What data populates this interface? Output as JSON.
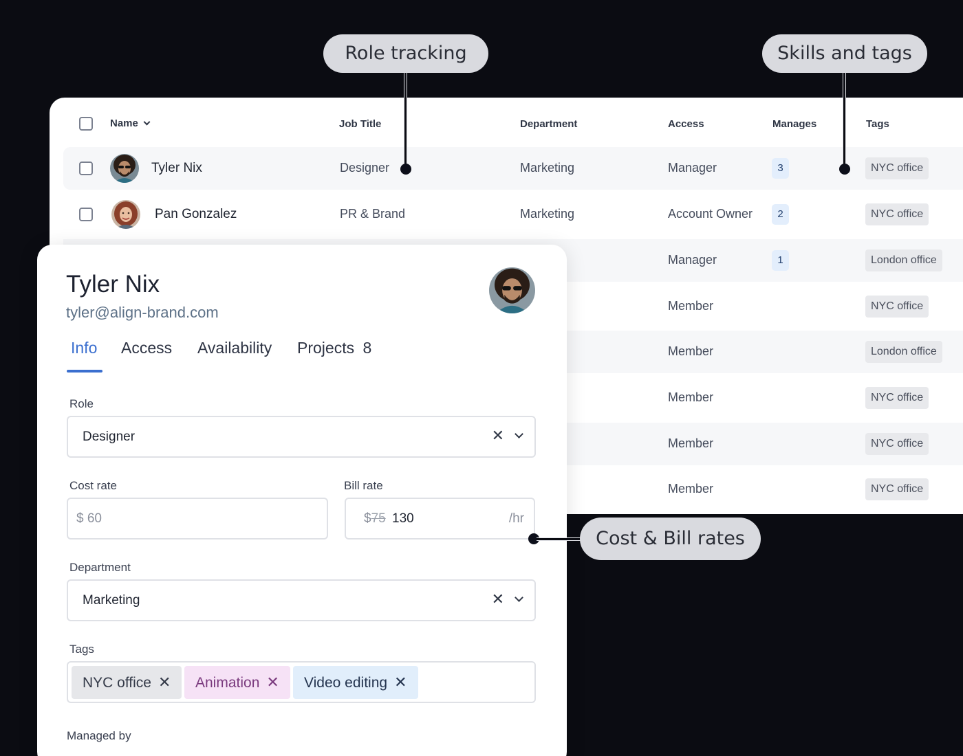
{
  "callouts": {
    "role_tracking": "Role tracking",
    "skills_tags": "Skills and tags",
    "cost_bill": "Cost & Bill rates"
  },
  "table": {
    "columns": [
      "Name",
      "Job Title",
      "Department",
      "Access",
      "Manages",
      "Tags"
    ],
    "rows": [
      {
        "name": "Tyler Nix",
        "job_title": "Designer",
        "department": "Marketing",
        "access": "Manager",
        "manages": "3",
        "tag": "NYC office"
      },
      {
        "name": "Pan Gonzalez",
        "job_title": "PR & Brand",
        "department": "Marketing",
        "access": "Account Owner",
        "manages": "2",
        "tag": "NYC office"
      },
      {
        "access": "Manager",
        "manages": "1",
        "tag": "London office"
      },
      {
        "access": "Member",
        "tag": "NYC office"
      },
      {
        "access": "Member",
        "tag": "London office"
      },
      {
        "access": "Member",
        "tag": "NYC office"
      },
      {
        "access": "Member",
        "tag": "NYC office"
      },
      {
        "access": "Member",
        "tag": "NYC office"
      }
    ]
  },
  "panel": {
    "name": "Tyler Nix",
    "email": "tyler@align-brand.com",
    "tabs": {
      "info": "Info",
      "access": "Access",
      "availability": "Availability",
      "projects": "Projects",
      "projects_count": "8"
    },
    "role": {
      "label": "Role",
      "value": "Designer"
    },
    "cost_rate": {
      "label": "Cost rate",
      "currency": "$",
      "value": "60"
    },
    "bill_rate": {
      "label": "Bill rate",
      "currency": "$",
      "old_value": "75",
      "value": "130",
      "unit": "/hr"
    },
    "department": {
      "label": "Department",
      "value": "Marketing"
    },
    "tags": {
      "label": "Tags",
      "items": [
        "NYC office",
        "Animation",
        "Video editing"
      ]
    },
    "managed_by": {
      "label": "Managed by"
    }
  },
  "colors": {
    "background": "#0b0c12",
    "accent": "#3b6fcf",
    "chip_gray": "#e6e7ea",
    "chip_purple": "#f6e2f6",
    "chip_blue": "#e1eefb",
    "badge": "#e3eefc"
  }
}
